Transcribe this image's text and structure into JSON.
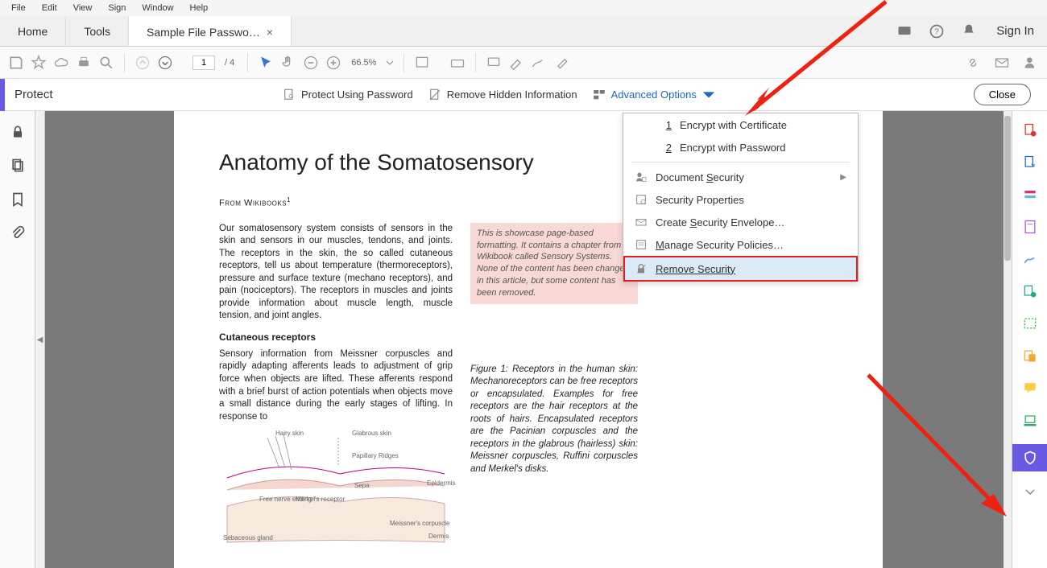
{
  "menubar": [
    "File",
    "Edit",
    "View",
    "Sign",
    "Window",
    "Help"
  ],
  "tabs": {
    "home": "Home",
    "tools": "Tools",
    "doc": "Sample File Passwo…"
  },
  "signin": "Sign In",
  "toolbar": {
    "page_current": "1",
    "page_total": "/  4",
    "zoom": "66.5%"
  },
  "protect": {
    "title": "Protect",
    "password": "Protect Using Password",
    "remove_hidden": "Remove Hidden Information",
    "advanced": "Advanced Options",
    "close": "Close"
  },
  "dropdown": {
    "n1": "1",
    "encrypt_cert": "Encrypt with Certificate",
    "n2": "2",
    "encrypt_pw": "Encrypt with Password",
    "doc_security_pre": "Document ",
    "doc_security_k": "S",
    "doc_security_post": "ecurity",
    "sec_props": "Security Properties",
    "envelope_pre": "Create ",
    "envelope_k": "S",
    "envelope_post": "ecurity Envelope…",
    "policies_pre": "",
    "policies_k": "M",
    "policies_post": "anage Security Policies…",
    "remove_pre": "",
    "remove_k": "R",
    "remove_post": "emove Security"
  },
  "doc": {
    "title": "Anatomy of the Somatosensory",
    "from_pre": "From Wikibooks",
    "from_sup": "1",
    "p1": "Our somatosensory system consists of sensors in the skin and sensors in our muscles, tendons, and joints. The receptors in the skin, the so called cutaneous receptors, tell us about temperature (thermoreceptors), pressure and surface texture (mechano receptors), and pain (nociceptors). The receptors in muscles and joints provide information about muscle length, muscle tension, and joint angles.",
    "sub1": "Cutaneous receptors",
    "p2": "Sensory information from Meissner corpuscles and rapidly adapting afferents leads to adjustment of grip force when objects are lifted. These afferents respond with a brief burst of action potentials when objects move a small distance during the early stages of lifting. In response to",
    "pink": "showcase page-based formatting. It contains a chapter from a Wikibook called Sensory Systems. None of the content has been changed in this article, but some content has been removed.",
    "pink_pre": "This is",
    "figcap": "Figure 1: Receptors in the human skin: Mechanoreceptors can be free receptors or encapsulated. Examples for free receptors are the hair receptors at the roots of hairs. Encapsulated receptors are the Pacinian corpuscles and the receptors in the glabrous (hairless) skin: Meissner corpuscles, Ruffini corpuscles and Merkel's disks.",
    "fig_labels": {
      "hairy": "Hairy skin",
      "glab": "Glabrous skin",
      "pap": "Papillary Ridges",
      "nerve": "Free nerve ending",
      "merkel": "Merkel's receptor",
      "epi": "Epidermis",
      "dermis": "Dermis",
      "meis": "Meissner's corpuscle",
      "sep": "Sepa",
      "seb": "Sebaceous gland"
    }
  }
}
